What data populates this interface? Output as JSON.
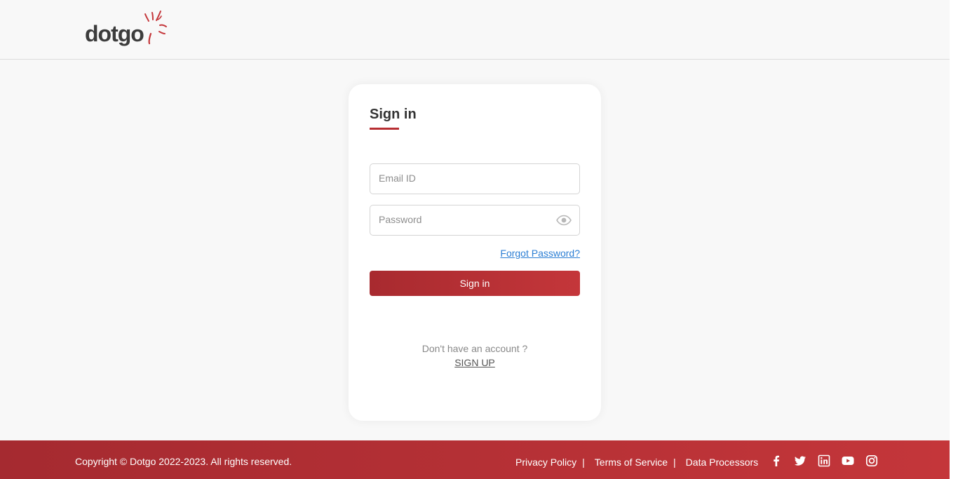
{
  "header": {
    "logo_text": "dotgo"
  },
  "signin": {
    "title": "Sign in",
    "email_placeholder": "Email ID",
    "password_placeholder": "Password",
    "forgot_label": "Forgot Password?",
    "button_label": "Sign in",
    "no_account_text": "Don't have an account ?",
    "signup_label": "SIGN UP"
  },
  "footer": {
    "copyright": "Copyright © Dotgo 2022-2023. All rights reserved.",
    "links": [
      "Privacy Policy",
      "Terms of Service",
      "Data Processors"
    ],
    "separator": "|",
    "social_icons": [
      "facebook-icon",
      "twitter-icon",
      "linkedin-icon",
      "youtube-icon",
      "instagram-icon"
    ]
  },
  "colors": {
    "brand_red": "#b72e32",
    "link_blue": "#2b7ed4",
    "background": "#f8f8f8"
  }
}
